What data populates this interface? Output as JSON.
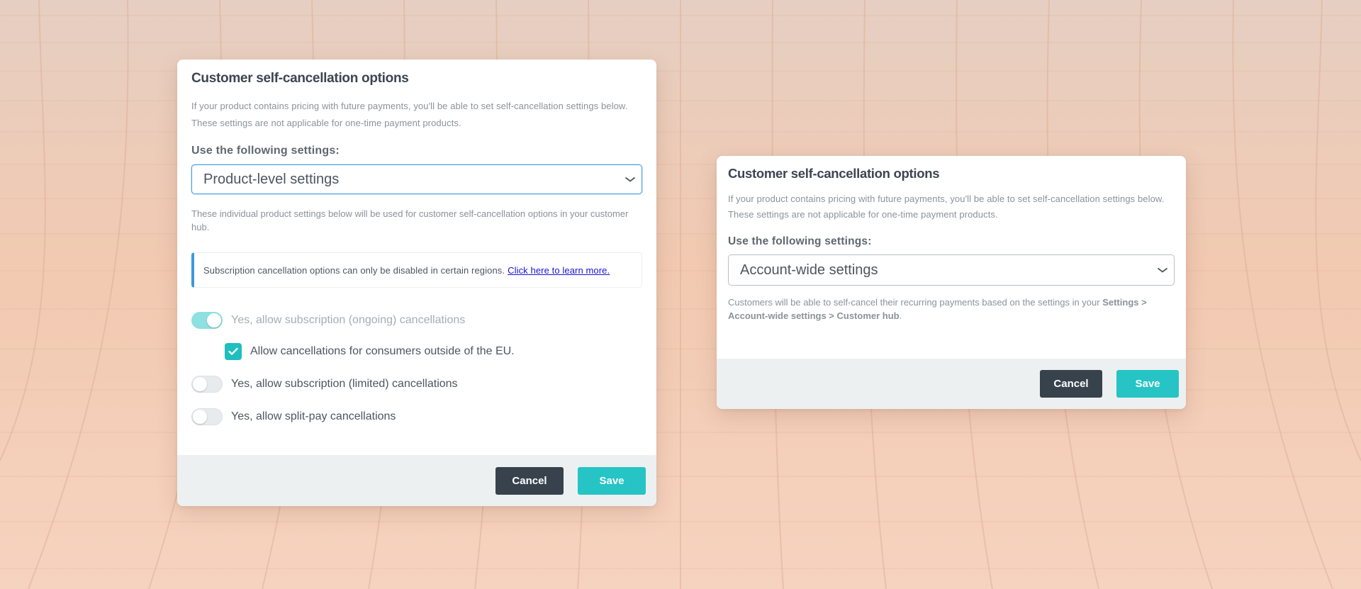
{
  "modal_left": {
    "title": "Customer self-cancellation options",
    "description": "If your product contains pricing with future payments, you'll be able to set self-cancellation settings below. These settings are not applicable for one-time payment products.",
    "settings_label": "Use the following settings:",
    "selected_setting": "Product-level settings",
    "hint": "These individual product settings below will be used for customer self-cancellation options in your customer hub.",
    "alert_text": "Subscription cancellation options can only be disabled in certain regions.",
    "alert_link": "Click here to learn more.",
    "options": {
      "ongoing": {
        "label": "Yes, allow subscription (ongoing) cancellations",
        "enabled": true
      },
      "outside_eu": {
        "label": "Allow cancellations for consumers outside of the EU.",
        "checked": true
      },
      "limited": {
        "label": "Yes, allow subscription (limited) cancellations",
        "enabled": false
      },
      "split_pay": {
        "label": "Yes, allow split-pay cancellations",
        "enabled": false
      }
    },
    "cancel_label": "Cancel",
    "save_label": "Save"
  },
  "modal_right": {
    "title": "Customer self-cancellation options",
    "description": "If your product contains pricing with future payments, you'll be able to set self-cancellation settings below. These settings are not applicable for one-time payment products.",
    "settings_label": "Use the following settings:",
    "selected_setting": "Account-wide settings",
    "hint_prefix": "Customers will be able to self-cancel their recurring payments based on the settings in your",
    "hint_bold": "Settings > Account-wide settings > Customer hub",
    "hint_suffix": ".",
    "cancel_label": "Cancel",
    "save_label": "Save"
  },
  "colors": {
    "primary_teal": "#26c4c5",
    "dark_button": "#37424d",
    "focus_blue": "#4a9fe0",
    "alert_accent": "#3a9ad9",
    "link": "#1a12d8"
  },
  "icons": {
    "select_caret": "chevron-down-icon",
    "checkbox_mark": "check-icon"
  }
}
